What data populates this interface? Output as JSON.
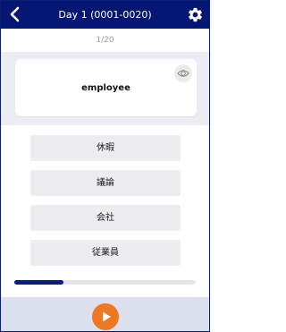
{
  "header": {
    "title": "Day 1 (0001-0020)",
    "back_icon": "chevron-left-icon",
    "settings_icon": "gear-icon"
  },
  "counter": "1/20",
  "card": {
    "word": "employee",
    "reveal_icon": "eye-icon"
  },
  "options": [
    "休暇",
    "議論",
    "会社",
    "従業員"
  ],
  "progress": {
    "current": 1,
    "total": 20,
    "fraction": 0.27
  },
  "controls": {
    "play_icon": "play-icon"
  },
  "colors": {
    "header_bg": "#061773",
    "progress_fill": "#0a1e78",
    "play_button": "#ee7722"
  }
}
